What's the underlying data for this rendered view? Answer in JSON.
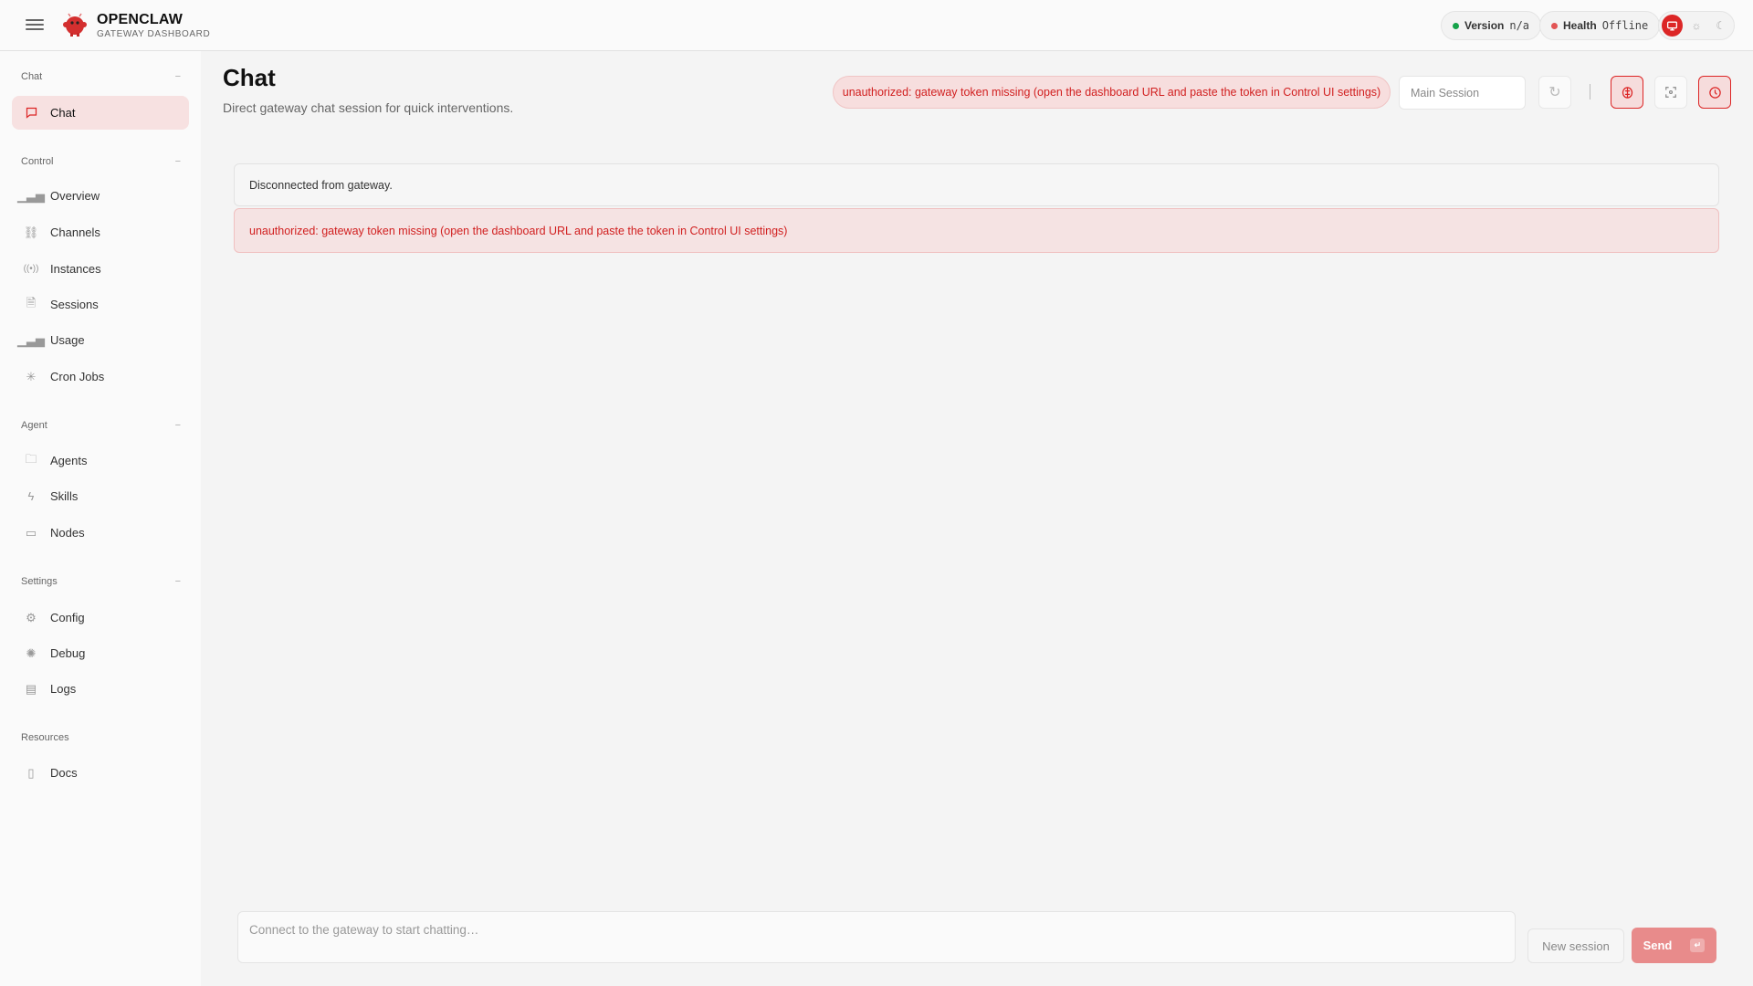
{
  "header": {
    "brand_title": "OPENCLAW",
    "brand_subtitle": "GATEWAY DASHBOARD",
    "version_label": "Version",
    "version_value": "n/a",
    "health_label": "Health",
    "health_value": "Offline"
  },
  "colors": {
    "accent": "#dc2626",
    "ok": "#16a34a",
    "error": "#e25555"
  },
  "sidebar": {
    "sections": [
      {
        "label": "Chat",
        "items": [
          {
            "label": "Chat",
            "icon": "message-icon"
          }
        ]
      },
      {
        "label": "Control",
        "items": [
          {
            "label": "Overview",
            "icon": "bar-chart-icon"
          },
          {
            "label": "Channels",
            "icon": "link-icon"
          },
          {
            "label": "Instances",
            "icon": "radio-icon"
          },
          {
            "label": "Sessions",
            "icon": "file-icon"
          },
          {
            "label": "Usage",
            "icon": "bar-chart-icon"
          },
          {
            "label": "Cron Jobs",
            "icon": "loader-icon"
          }
        ]
      },
      {
        "label": "Agent",
        "items": [
          {
            "label": "Agents",
            "icon": "folder-icon"
          },
          {
            "label": "Skills",
            "icon": "bolt-icon"
          },
          {
            "label": "Nodes",
            "icon": "monitor-icon"
          }
        ]
      },
      {
        "label": "Settings",
        "items": [
          {
            "label": "Config",
            "icon": "gear-icon"
          },
          {
            "label": "Debug",
            "icon": "bug-icon"
          },
          {
            "label": "Logs",
            "icon": "scroll-icon"
          }
        ]
      },
      {
        "label": "Resources",
        "items": [
          {
            "label": "Docs",
            "icon": "book-icon"
          }
        ]
      }
    ],
    "collapse_symbol": "−"
  },
  "main": {
    "title": "Chat",
    "subtitle": "Direct gateway chat session for quick interventions.",
    "error_pill": "unauthorized: gateway token missing (open the dashboard URL and paste the token in Control UI settings)",
    "session_select": "Main Session",
    "status_message": "Disconnected from gateway.",
    "error_message": "unauthorized: gateway token missing (open the dashboard URL and paste the token in Control UI settings)",
    "composer_placeholder": "Connect to the gateway to start chatting…",
    "new_session_label": "New session",
    "send_label": "Send",
    "send_key": "↵"
  }
}
